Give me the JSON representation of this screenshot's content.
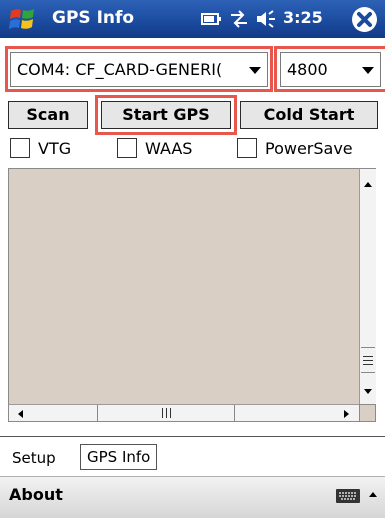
{
  "titlebar": {
    "title": "GPS Info",
    "time": "3:25"
  },
  "port_combo": {
    "value": "COM4:  CF_CARD-GENERI("
  },
  "baud_combo": {
    "value": "4800"
  },
  "buttons": {
    "scan": "Scan",
    "start_gps": "Start GPS",
    "cold_start": "Cold Start"
  },
  "checkboxes": {
    "vtg": "VTG",
    "waas": "WAAS",
    "powersave": "PowerSave"
  },
  "tabs": {
    "setup": "Setup",
    "gps_info": "GPS Info"
  },
  "menubar": {
    "about": "About"
  },
  "colors": {
    "titlebar": "#1a4a9d",
    "highlight": "#e8574e",
    "panel": "#d9cfc4"
  }
}
